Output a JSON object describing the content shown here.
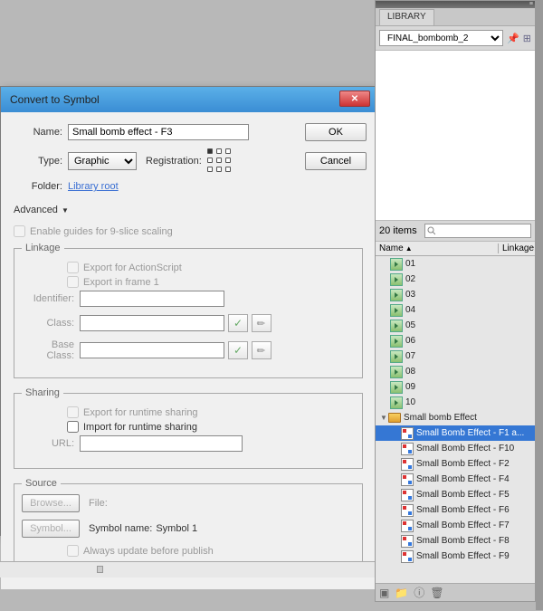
{
  "dialog": {
    "title": "Convert to Symbol",
    "name_label": "Name:",
    "name_value": "Small bomb effect - F3",
    "type_label": "Type:",
    "type_value": "Graphic",
    "registration_label": "Registration:",
    "folder_label": "Folder:",
    "folder_link": "Library root",
    "advanced_label": "Advanced",
    "nine_slice": "Enable guides for 9-slice scaling",
    "linkage": {
      "legend": "Linkage",
      "export_as": "Export for ActionScript",
      "export_f1": "Export in frame 1",
      "identifier_label": "Identifier:",
      "class_label": "Class:",
      "base_label": "Base Class:"
    },
    "sharing": {
      "legend": "Sharing",
      "export_rt": "Export for runtime sharing",
      "import_rt": "Import for runtime sharing",
      "url_label": "URL:"
    },
    "source": {
      "legend": "Source",
      "browse_btn": "Browse...",
      "file_label": "File:",
      "symbol_btn": "Symbol...",
      "symbol_name_label": "Symbol name:",
      "symbol_name_value": "Symbol 1",
      "always_update": "Always update before publish"
    },
    "ok": "OK",
    "cancel": "Cancel"
  },
  "library": {
    "tab": "LIBRARY",
    "doc": "FINAL_bombomb_2",
    "count": "20 items",
    "search_placeholder": "",
    "header_name": "Name",
    "header_linkage": "Linkage",
    "items": [
      {
        "label": "01",
        "type": "clip"
      },
      {
        "label": "02",
        "type": "clip"
      },
      {
        "label": "03",
        "type": "clip"
      },
      {
        "label": "04",
        "type": "clip"
      },
      {
        "label": "05",
        "type": "clip"
      },
      {
        "label": "06",
        "type": "clip"
      },
      {
        "label": "07",
        "type": "clip"
      },
      {
        "label": "08",
        "type": "clip"
      },
      {
        "label": "09",
        "type": "clip"
      },
      {
        "label": "10",
        "type": "clip"
      }
    ],
    "folder": "Small bomb Effect",
    "subitems": [
      {
        "label": "Small Bomb Effect - F1 a...",
        "sel": true
      },
      {
        "label": "Small Bomb Effect - F10"
      },
      {
        "label": "Small Bomb Effect - F2"
      },
      {
        "label": "Small Bomb Effect - F4"
      },
      {
        "label": "Small Bomb Effect - F5"
      },
      {
        "label": "Small Bomb Effect - F6"
      },
      {
        "label": "Small Bomb Effect - F7"
      },
      {
        "label": "Small Bomb Effect - F8"
      },
      {
        "label": "Small Bomb Effect - F9"
      }
    ]
  }
}
